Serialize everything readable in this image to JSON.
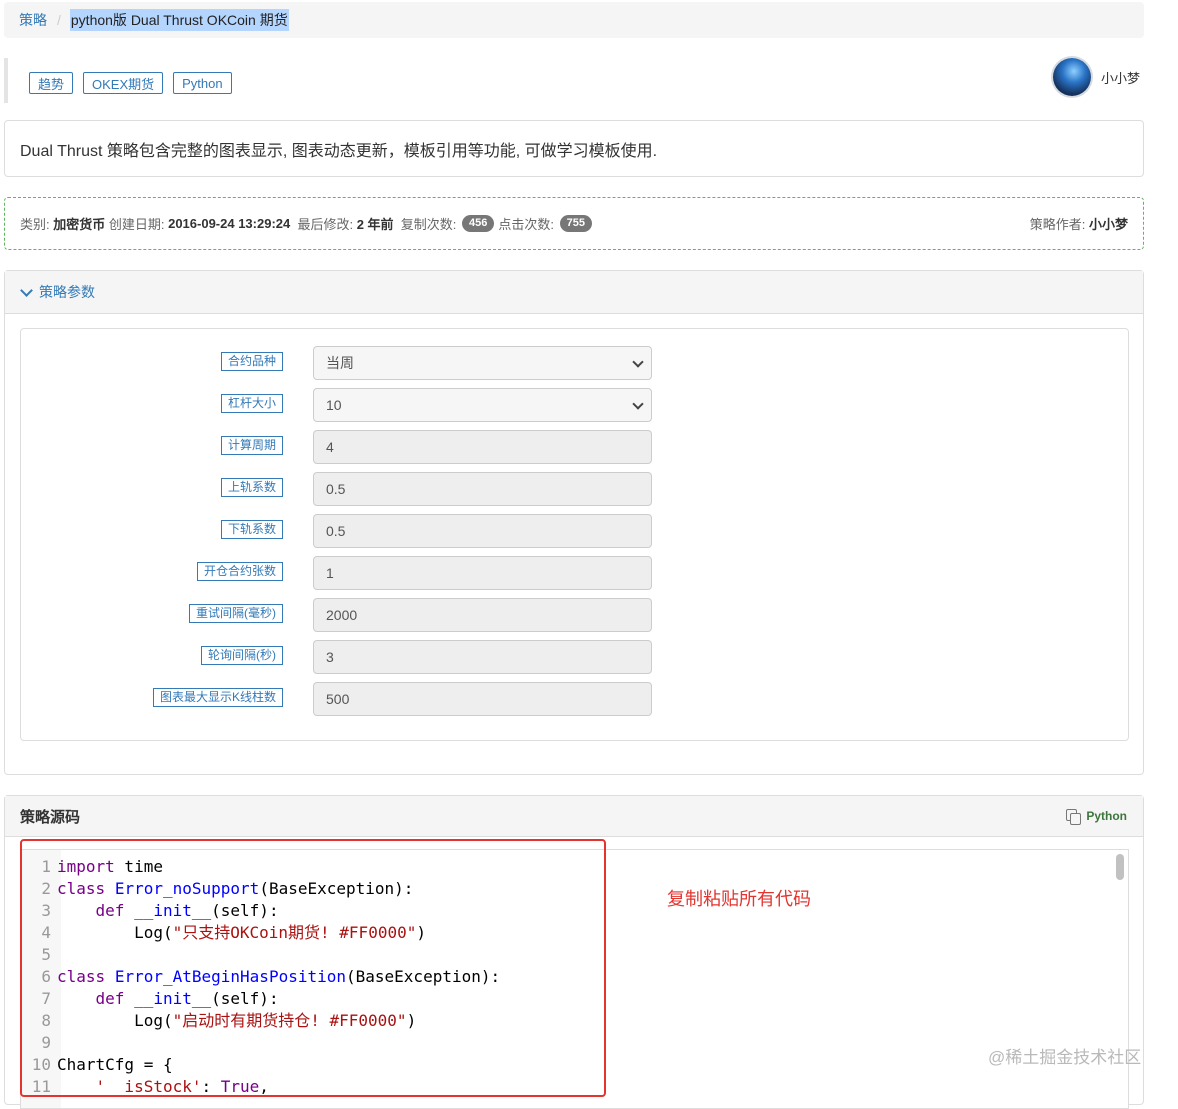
{
  "breadcrumb": {
    "root": "策略",
    "current": "python版 Dual Thrust OKCoin 期货"
  },
  "tags": [
    "趋势",
    "OKEX期货",
    "Python"
  ],
  "author": {
    "name": "小小梦"
  },
  "description": "Dual Thrust 策略包含完整的图表显示, 图表动态更新，模板引用等功能, 可做学习模板使用.",
  "meta": {
    "category_label": "类别: ",
    "category_value": "加密货币",
    "created_label": " 创建日期: ",
    "created_value": "2016-09-24 13:29:24",
    "modified_label": "  最后修改: ",
    "modified_value": "2 年前",
    "copies_label": "  复制次数: ",
    "copies_value": "456",
    "clicks_label": "点击次数: ",
    "clicks_value": "755",
    "author_label": "策略作者: ",
    "author_value": "小小梦"
  },
  "params_panel": {
    "title": "策略参数",
    "params": [
      {
        "label": "合约品种",
        "value": "当周",
        "type": "select"
      },
      {
        "label": "杠杆大小",
        "value": "10",
        "type": "select"
      },
      {
        "label": "计算周期",
        "value": "4",
        "type": "input"
      },
      {
        "label": "上轨系数",
        "value": "0.5",
        "type": "input"
      },
      {
        "label": "下轨系数",
        "value": "0.5",
        "type": "input"
      },
      {
        "label": "开仓合约张数",
        "value": "1",
        "type": "input"
      },
      {
        "label": "重试间隔(毫秒)",
        "value": "2000",
        "type": "input"
      },
      {
        "label": "轮询间隔(秒)",
        "value": "3",
        "type": "input"
      },
      {
        "label": "图表最大显示K线柱数",
        "value": "500",
        "type": "input"
      }
    ]
  },
  "code_panel": {
    "title": "策略源码",
    "language": "Python",
    "lines": [
      {
        "n": "1",
        "parts": [
          [
            "kw",
            "import"
          ],
          [
            "tx",
            " time"
          ]
        ]
      },
      {
        "n": "2",
        "parts": [
          [
            "kw",
            "class"
          ],
          [
            "tx",
            " "
          ],
          [
            "nm",
            "Error_noSupport"
          ],
          [
            "tx",
            "(BaseException):"
          ]
        ]
      },
      {
        "n": "3",
        "parts": [
          [
            "tx",
            "    "
          ],
          [
            "kw",
            "def"
          ],
          [
            "tx",
            " "
          ],
          [
            "nm",
            "__init__"
          ],
          [
            "tx",
            "(self):"
          ]
        ]
      },
      {
        "n": "4",
        "parts": [
          [
            "tx",
            "        Log("
          ],
          [
            "st",
            "\"只支持OKCoin期货! #FF0000\""
          ],
          [
            "tx",
            ")"
          ]
        ]
      },
      {
        "n": "5",
        "parts": []
      },
      {
        "n": "6",
        "parts": [
          [
            "kw",
            "class"
          ],
          [
            "tx",
            " "
          ],
          [
            "nm",
            "Error_AtBeginHasPosition"
          ],
          [
            "tx",
            "(BaseException):"
          ]
        ]
      },
      {
        "n": "7",
        "parts": [
          [
            "tx",
            "    "
          ],
          [
            "kw",
            "def"
          ],
          [
            "tx",
            " "
          ],
          [
            "nm",
            "__init__"
          ],
          [
            "tx",
            "(self):"
          ]
        ]
      },
      {
        "n": "8",
        "parts": [
          [
            "tx",
            "        Log("
          ],
          [
            "st",
            "\"启动时有期货持仓! #FF0000\""
          ],
          [
            "tx",
            ")"
          ]
        ]
      },
      {
        "n": "9",
        "parts": []
      },
      {
        "n": "10",
        "parts": [
          [
            "tx",
            "ChartCfg = {"
          ]
        ]
      },
      {
        "n": "11",
        "parts": [
          [
            "tx",
            "    "
          ],
          [
            "st",
            "'__isStock'"
          ],
          [
            "tx",
            ": "
          ],
          [
            "kw",
            "True"
          ],
          [
            "tx",
            ","
          ]
        ]
      }
    ]
  },
  "annotation": "复制粘贴所有代码",
  "watermark": "@稀土掘金技术社区",
  "colors": {
    "link": "#337ab7",
    "annotation": "#e3342f",
    "meta_border": "#5cb85c"
  }
}
